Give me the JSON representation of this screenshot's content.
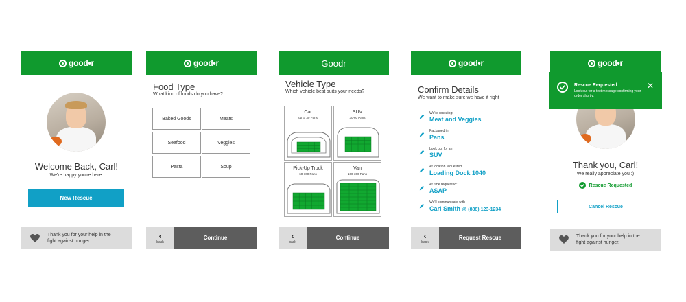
{
  "brand": {
    "logo_text": "good•r",
    "alt_header": "Goodr",
    "primary": "#109a2e",
    "accent": "#11a0c6"
  },
  "welcome": {
    "title": "Welcome Back, Carl!",
    "subtitle": "We're happy you're here.",
    "button": "New Rescue",
    "footer": "Thank you for your help in the fight against hunger."
  },
  "food": {
    "title": "Food Type",
    "subtitle": "What kind of foods do you have?",
    "options": [
      "Baked Goods",
      "Meats",
      "Seafood",
      "Veggies",
      "Pasta",
      "Soup"
    ],
    "back": "back",
    "continue": "Continue"
  },
  "vehicle": {
    "title": "Vehicle Type",
    "subtitle": "Which vehicle best suits your needs?",
    "options": [
      {
        "name": "Car",
        "capacity": "up to 30 Pans"
      },
      {
        "name": "SUV",
        "capacity": "30-60 Pans"
      },
      {
        "name": "Pick-Up Truck",
        "capacity": "60-100 Pans"
      },
      {
        "name": "Van",
        "capacity": "100-300 Pans"
      }
    ],
    "back": "back",
    "continue": "Continue"
  },
  "confirm": {
    "title": "Confirm Details",
    "subtitle": "We want to make sure we have it right",
    "details": [
      {
        "label": "We're rescuing:",
        "value": "Meat and Veggies"
      },
      {
        "label": "Packaged in",
        "value": "Pans"
      },
      {
        "label": "Look out for an",
        "value": "SUV"
      },
      {
        "label": "At location requested:",
        "value": "Loading Dock 1040"
      },
      {
        "label": "At time requested:",
        "value": "ASAP"
      },
      {
        "label": "We'll communicate with",
        "value": "Carl Smith",
        "phone": "@ (888) 123-1234"
      }
    ],
    "back": "back",
    "button": "Request Rescue"
  },
  "done": {
    "toast_title": "Rescue Requested",
    "toast_body": "Look out for a text message confirming your order shortly.",
    "title": "Thank you, Carl!",
    "subtitle": "We really appreciate you :)",
    "status": "Rescue Requested",
    "cancel": "Cancel Rescue",
    "footer": "Thank you for your help in the fight against hunger."
  }
}
